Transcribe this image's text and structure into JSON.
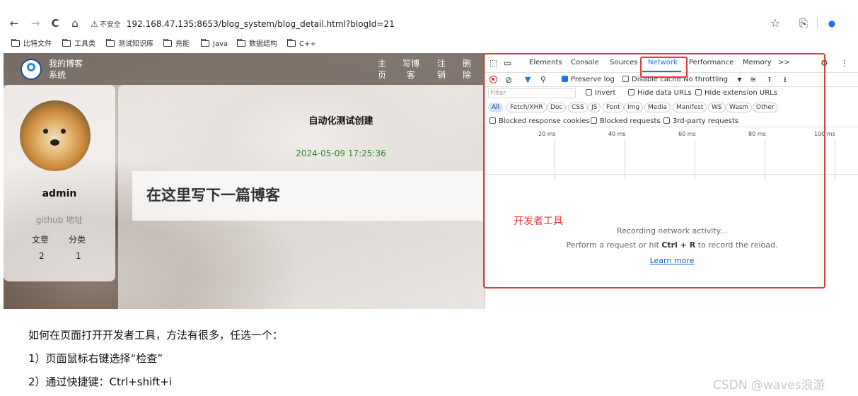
{
  "browser": {
    "back": "←",
    "forward": "→",
    "reload": "C",
    "home": "⌂",
    "insecure_label": "不安全",
    "url": "192.168.47.135:8653/blog_system/blog_detail.html?blogId=21",
    "star": "☆",
    "extensions": "⎘",
    "profile": "●",
    "bookmarks": [
      "比特文件",
      "工具类",
      "测试知识库",
      "充能",
      "Java",
      "数据结构",
      "C++"
    ]
  },
  "site": {
    "name_line1": "我的博客",
    "name_line2": "系统",
    "nav": [
      {
        "l1": "主",
        "l2": "页"
      },
      {
        "l1": "写博",
        "l2": "客"
      },
      {
        "l1": "注",
        "l2": "销"
      },
      {
        "l1": "删",
        "l2": "除"
      }
    ],
    "user": {
      "name": "admin",
      "github": "github 地址",
      "articles_label": "文章",
      "categories_label": "分类",
      "articles_count": "2",
      "categories_count": "1"
    },
    "blog": {
      "title": "自动化测试创建",
      "date": "2024-05-09 17:25:36",
      "content": "在这里写下一篇博客"
    }
  },
  "devtools": {
    "tabs": [
      "Elements",
      "Console",
      "Sources",
      "Network",
      "Performance",
      "Memory",
      ">>"
    ],
    "active_tab": "Network",
    "toolbar": {
      "preserve_log": "Preserve log",
      "disable_cache": "Disable cache",
      "throttling": "No throttling"
    },
    "filter": {
      "placeholder": "Filter",
      "invert": "Invert",
      "hide_data_urls": "Hide data URLs",
      "hide_extension_urls": "Hide extension URLs"
    },
    "type_chips": [
      "All",
      "Fetch/XHR",
      "Doc",
      "CSS",
      "JS",
      "Font",
      "Img",
      "Media",
      "Manifest",
      "WS",
      "Wasm",
      "Other"
    ],
    "options": {
      "blocked_cookies": "Blocked response cookies",
      "blocked_requests": "Blocked requests",
      "third_party": "3rd-party requests"
    },
    "timeline_ticks": [
      "20 ms",
      "40 ms",
      "60 ms",
      "80 ms",
      "100 ms"
    ],
    "empty": {
      "recording": "Recording network activity...",
      "hint_pre": "Perform a request or hit ",
      "hint_key": "Ctrl + R",
      "hint_post": " to record the reload.",
      "learn_more": "Learn more"
    }
  },
  "annotation": {
    "label": "开发者工具",
    "color": "#e53935"
  },
  "article": {
    "lines": [
      "如何在页面打开开发者工具，方法有很多，任选一个：",
      "1）页面鼠标右键选择“检查”",
      "2）通过快捷键：Ctrl+shift+i"
    ],
    "watermark": "CSDN @waves浪游"
  }
}
